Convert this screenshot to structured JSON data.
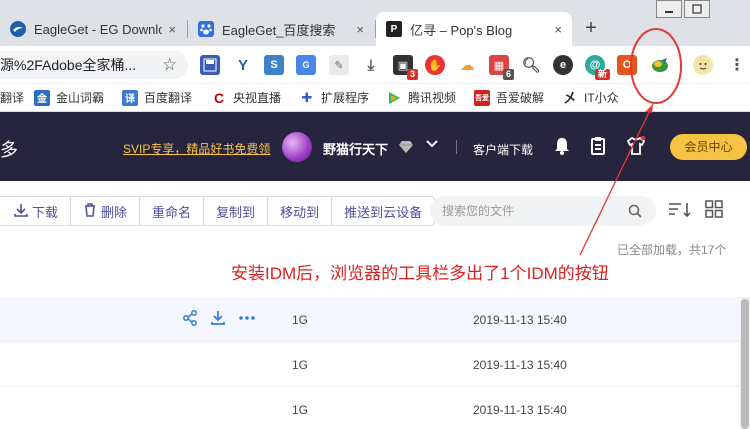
{
  "tabs": [
    {
      "title": "EagleGet - EG Downlo",
      "favicon": "eagleget-icon",
      "close": "×"
    },
    {
      "title": "EagleGet_百度搜索",
      "favicon": "baidu-paw-icon",
      "close": "×"
    },
    {
      "title": "亿寻 – Pop's Blog",
      "favicon": "p-logo-icon",
      "close": "×"
    }
  ],
  "new_tab": "+",
  "window_controls": {
    "minimize": "—",
    "maximize": "☐"
  },
  "address_bar": {
    "value": "源%2FAdobe全家桶..."
  },
  "extensions": {
    "badges": {
      "tasks": "3",
      "mail": "6"
    },
    "items": [
      "save-icon",
      "vue-devtools-icon",
      "s-icon",
      "translate-icon",
      "edit-icon",
      "download-arrow-icon",
      "ext-badge-icon",
      "adblock-icon",
      "cloud-icon",
      "mail-icon",
      "search-icon",
      "e-icon",
      "new-icon",
      "office-icon",
      "idm-icon",
      "profile-avatar-icon"
    ],
    "new_label": "新"
  },
  "bookmarks": [
    {
      "label": "翻译",
      "icon": "translate-bookmark-icon"
    },
    {
      "label": "金山词霸",
      "icon": "kingsoft-icon"
    },
    {
      "label": "百度翻译",
      "icon": "baidu-translate-icon"
    },
    {
      "label": "央视直播",
      "icon": "cctv-icon"
    },
    {
      "label": "扩展程序",
      "icon": "puzzle-icon"
    },
    {
      "label": "腾讯视频",
      "icon": "tencent-video-icon"
    },
    {
      "label": "吾爱破解",
      "icon": "52pojie-icon"
    },
    {
      "label": "IT小众",
      "icon": "it-icon"
    }
  ],
  "app_header": {
    "more": "更多",
    "svip_promo": "SVIP专享，精品好书免费领",
    "username": "野猫行天下",
    "client_download": "客户端下载",
    "vip_center": "会员中心"
  },
  "toolbar": {
    "download": "下载",
    "delete": "删除",
    "rename": "重命名",
    "copy_to": "复制到",
    "move_to": "移动到",
    "push_to_cloud": "推送到云设备",
    "search_placeholder": "搜索您的文件"
  },
  "status_text": "已全部加载，共17个",
  "annotation": "安装IDM后，浏览器的工具栏多出了1个IDM的按钮",
  "files": [
    {
      "size": "1G",
      "date": "2019-11-13 15:40"
    },
    {
      "size": "1G",
      "date": "2019-11-13 15:40"
    },
    {
      "size": "1G",
      "date": "2019-11-13 15:40"
    }
  ],
  "colors": {
    "header_bg": "#27243e",
    "accent_gold": "#f5c242",
    "link_blue": "#3a7bd5",
    "annotation_red": "#e02020",
    "toolbar_text": "#4c4fa0"
  }
}
